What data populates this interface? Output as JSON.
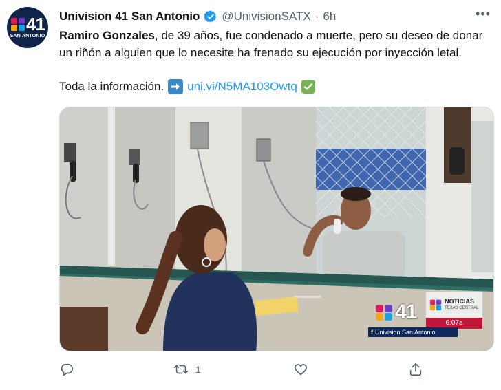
{
  "account": {
    "avatar_number": "41",
    "avatar_label": "SAN ANTONIO",
    "name": "Univision 41 San Antonio",
    "handle": "@UnivisionSATX",
    "separator": "·",
    "time": "6h"
  },
  "tweet": {
    "bold_name": "Ramiro Gonzales",
    "text": ", de 39 años, fue condenado a muerte, pero su deseo de donar un riñón a alguien que lo necesite ha frenado su ejecución por inyección letal.",
    "more_info": "Toda la información.",
    "link": "uni.vi/N5MA103Owtq"
  },
  "media": {
    "logo_number": "41",
    "brand_line1": "NOTICIAS",
    "brand_line2": "TEXAS CENTRAL",
    "clock": "6:07a",
    "social_handle": "Univision San Antonio"
  },
  "actions": {
    "reply_count": "",
    "retweet_count": "1",
    "like_count": ""
  },
  "icons": [
    "verified-icon",
    "more-icon",
    "arrow-right-emoji",
    "check-mark-emoji",
    "reply-icon",
    "retweet-icon",
    "like-icon",
    "share-icon"
  ],
  "colors": {
    "verified": "#1d9bf0",
    "link": "#1d9bf0",
    "muted": "#536471",
    "avatar_bg": "#0f2448"
  }
}
